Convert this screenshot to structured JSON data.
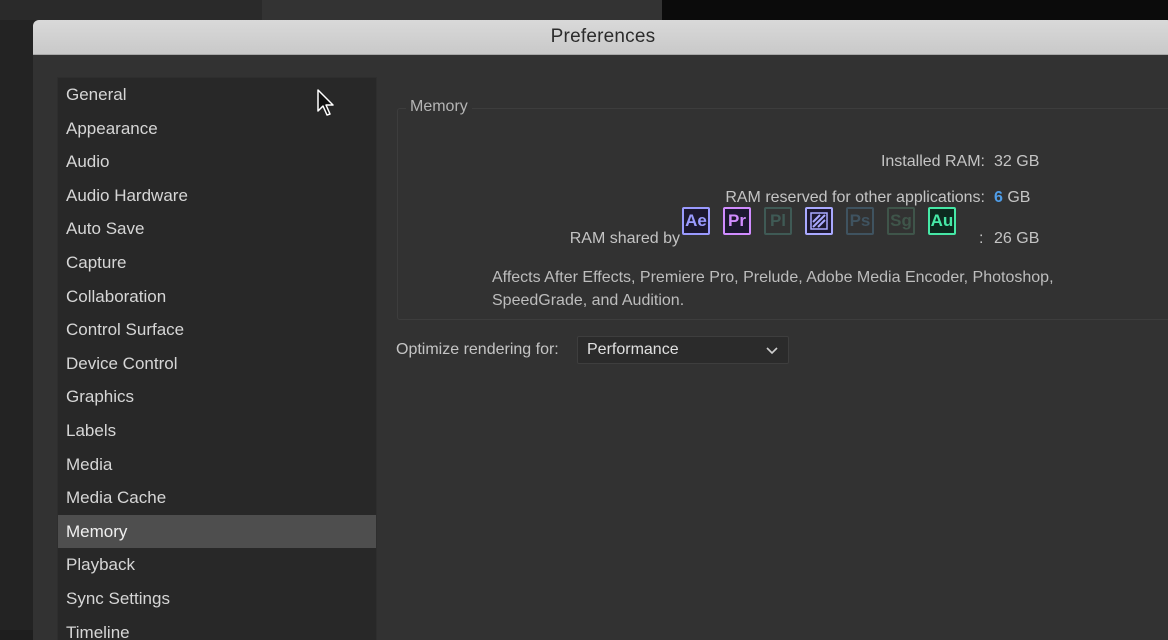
{
  "dialog": {
    "title": "Preferences"
  },
  "sidebar": {
    "items": [
      {
        "label": "General"
      },
      {
        "label": "Appearance"
      },
      {
        "label": "Audio"
      },
      {
        "label": "Audio Hardware"
      },
      {
        "label": "Auto Save"
      },
      {
        "label": "Capture"
      },
      {
        "label": "Collaboration"
      },
      {
        "label": "Control Surface"
      },
      {
        "label": "Device Control"
      },
      {
        "label": "Graphics"
      },
      {
        "label": "Labels"
      },
      {
        "label": "Media"
      },
      {
        "label": "Media Cache"
      },
      {
        "label": "Memory"
      },
      {
        "label": "Playback"
      },
      {
        "label": "Sync Settings"
      },
      {
        "label": "Timeline"
      }
    ],
    "selected": "Memory"
  },
  "memory": {
    "group_title": "Memory",
    "installed_ram_label": "Installed RAM:",
    "installed_ram_value": "32 GB",
    "reserved_label": "RAM reserved for other applications:",
    "reserved_number": "6",
    "reserved_unit": "GB",
    "shared_label": "RAM shared by",
    "shared_separator": ":",
    "shared_value": "26 GB",
    "apps": [
      {
        "abbr": "Ae",
        "icon": "after-effects-icon",
        "color": "#9a9aff",
        "active": true
      },
      {
        "abbr": "Pr",
        "icon": "premiere-pro-icon",
        "color": "#d08cff",
        "active": true
      },
      {
        "abbr": "Pl",
        "icon": "prelude-icon",
        "color": "#3f5a55",
        "active": false
      },
      {
        "abbr": "",
        "icon": "media-encoder-icon",
        "color": "#a9a9ff",
        "active": true
      },
      {
        "abbr": "Ps",
        "icon": "photoshop-icon",
        "color": "#3f5360",
        "active": false
      },
      {
        "abbr": "Sg",
        "icon": "speedgrade-icon",
        "color": "#3f554a",
        "active": false
      },
      {
        "abbr": "Au",
        "icon": "audition-icon",
        "color": "#46e8a6",
        "active": true
      }
    ],
    "description": "Affects After Effects, Premiere Pro, Prelude, Adobe Media Encoder, Photoshop, SpeedGrade, and Audition."
  },
  "rendering": {
    "label": "Optimize rendering for:",
    "selected": "Performance"
  }
}
